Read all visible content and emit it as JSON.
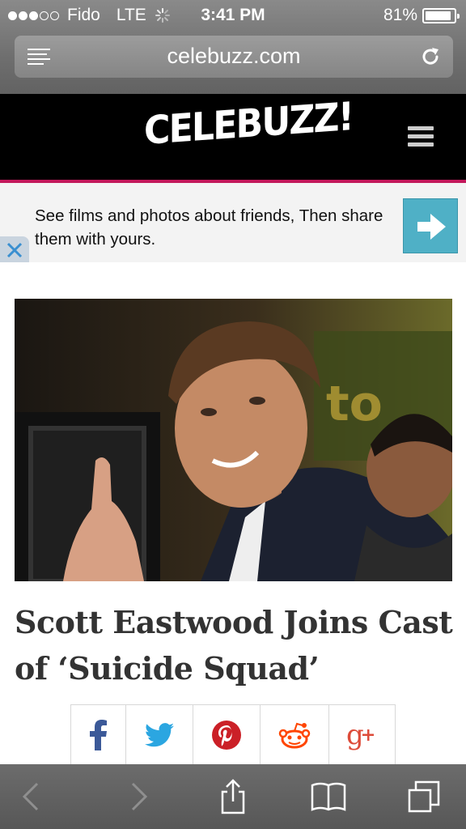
{
  "status_bar": {
    "carrier": "Fido",
    "network": "LTE",
    "time": "3:41 PM",
    "battery": "81%",
    "battery_level": 0.81,
    "signal_bars_filled": 3,
    "signal_bars_total": 5
  },
  "browser": {
    "url": "celebuzz.com",
    "icons": {
      "reader": "reader-list-icon",
      "reload": "reload-icon",
      "back": "chevron-left-icon",
      "forward": "chevron-right-icon",
      "share": "share-icon",
      "bookmarks": "book-icon",
      "tabs": "tabs-icon"
    }
  },
  "site": {
    "logo": "CELEBUZZ!",
    "accent_color": "#c2185b",
    "menu_icon": "hamburger-menu-icon"
  },
  "ad": {
    "text": "See films and photos about friends, Then share them with yours.",
    "arrow_icon": "arrow-right-icon",
    "close_icon": "close-x-icon",
    "button_color": "#4fb0c6"
  },
  "article": {
    "image_alt": "Scott Eastwood photo",
    "title": "Scott Eastwood Joins Cast of ‘Suicide Squad’"
  },
  "share_buttons": [
    {
      "name": "facebook",
      "glyph": "f",
      "color": "#3b5998"
    },
    {
      "name": "twitter",
      "glyph": "twitter",
      "color": "#2ba6e1"
    },
    {
      "name": "pinterest",
      "glyph": "P",
      "color": "#cb2027"
    },
    {
      "name": "reddit",
      "glyph": "reddit",
      "color": "#ff4500"
    },
    {
      "name": "google-plus",
      "glyph": "g+",
      "color": "#dd4b39"
    }
  ]
}
